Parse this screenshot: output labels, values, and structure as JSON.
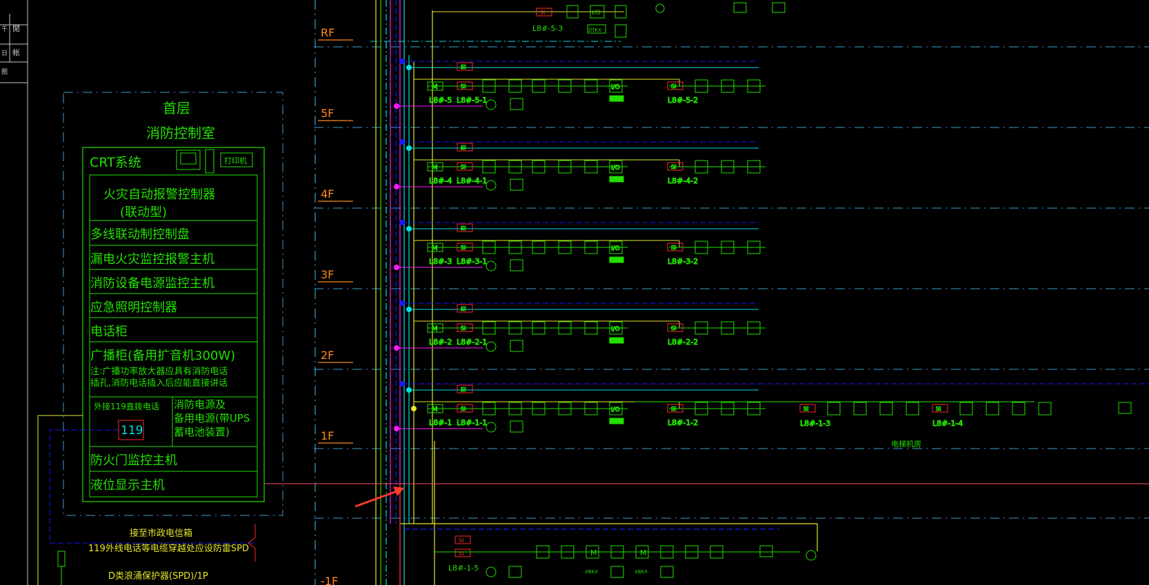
{
  "title_block": {
    "cells": [
      "千",
      "閒",
      "日",
      "帐",
      "图"
    ]
  },
  "control_room": {
    "floor": "首层",
    "name": "消防控制室",
    "crt": "CRT系统",
    "printer": "打印机",
    "rows": [
      "火灾自动报警控制器",
      "(联动型)",
      "多线联动制控制盘",
      "漏电火灾监控报警主机",
      "消防设备电源监控主机",
      "应急照明控制器",
      "电话柜",
      "广播柜(备用扩音机300W)",
      "注:广播功率放大器应具有消防电话",
      "插孔,消防电话插入后应能直接讲话",
      "外接119直拨电话",
      "消防电源及",
      "备用电源(带UPS",
      "蓄电池装置)",
      "防火门监控主机",
      "液位显示主机"
    ],
    "phone_box": "119"
  },
  "floors": [
    "RF",
    "5F",
    "4F",
    "3F",
    "2F",
    "1F",
    "-1F"
  ],
  "bottom_notes": [
    "接至市政电信箱",
    "119外线电话等电缆穿越处应设防雷SPD",
    "D类浪涌保护器(SPD)/1P"
  ],
  "labels": {
    "si": "SI",
    "io": "I/O",
    "m": "M",
    "dtkx": "DTKX",
    "xbkx": "XBKX",
    "lb": [
      "L8#-5-3",
      "L8#-5",
      "L8#-5-1",
      "L8#-5-2",
      "L8#-4",
      "L8#-4-1",
      "L8#-4-2",
      "L8#-3",
      "L8#-3-1",
      "L8#-3-2",
      "L8#-2",
      "L8#-2-1",
      "L8#-2-2",
      "L8#-1",
      "L8#-1-1",
      "L8#-1-2",
      "L8#-1-3",
      "L8#-1-4",
      "L8#-1-5"
    ],
    "elevator_room": "电梯机房"
  },
  "colors": {
    "green": "#22e000",
    "yellow": "#e6e62a",
    "orange": "#ff8a1c",
    "cyan": "#00e0e6",
    "magenta": "#ff1aff",
    "blue": "#1a1aff",
    "red": "#ff2a2a"
  }
}
